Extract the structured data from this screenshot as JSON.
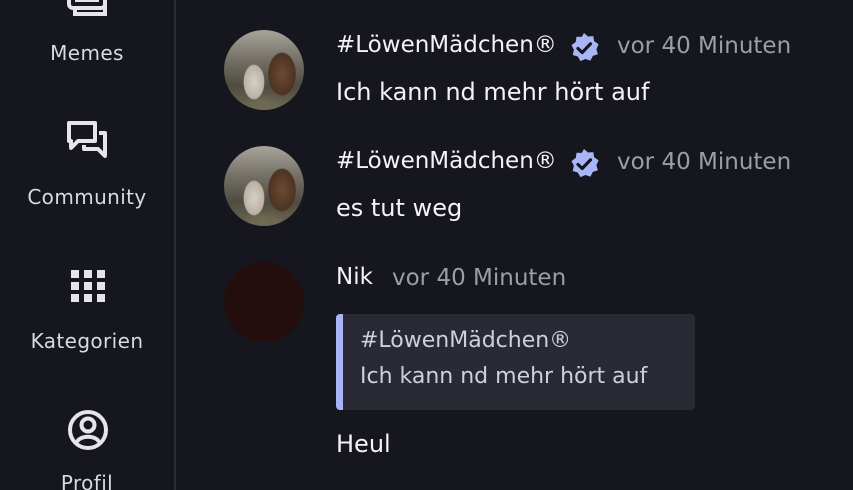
{
  "sidebar": {
    "items": [
      {
        "label": "Memes",
        "icon": "memes-icon"
      },
      {
        "label": "Community",
        "icon": "community-icon"
      },
      {
        "label": "Kategorien",
        "icon": "grid-icon"
      },
      {
        "label": "Profil",
        "icon": "profile-icon"
      }
    ]
  },
  "messages": [
    {
      "author": "#LöwenMädchen®",
      "verified": true,
      "time": "vor 40 Minuten",
      "text": "Ich kann nd mehr hört auf"
    },
    {
      "author": "#LöwenMädchen®",
      "verified": true,
      "time": "vor 40 Minuten",
      "text": "es tut weg"
    },
    {
      "author": "Nik",
      "verified": false,
      "time": "vor 40 Minuten",
      "quote": {
        "author": "#LöwenMädchen®",
        "text": "Ich kann nd mehr hört auf"
      },
      "text": "Heul"
    }
  ],
  "colors": {
    "background": "#16161e",
    "verified_badge": "#a9b6f6",
    "quote_accent": "#a7b4f5",
    "timestamp": "#9d9da8"
  }
}
